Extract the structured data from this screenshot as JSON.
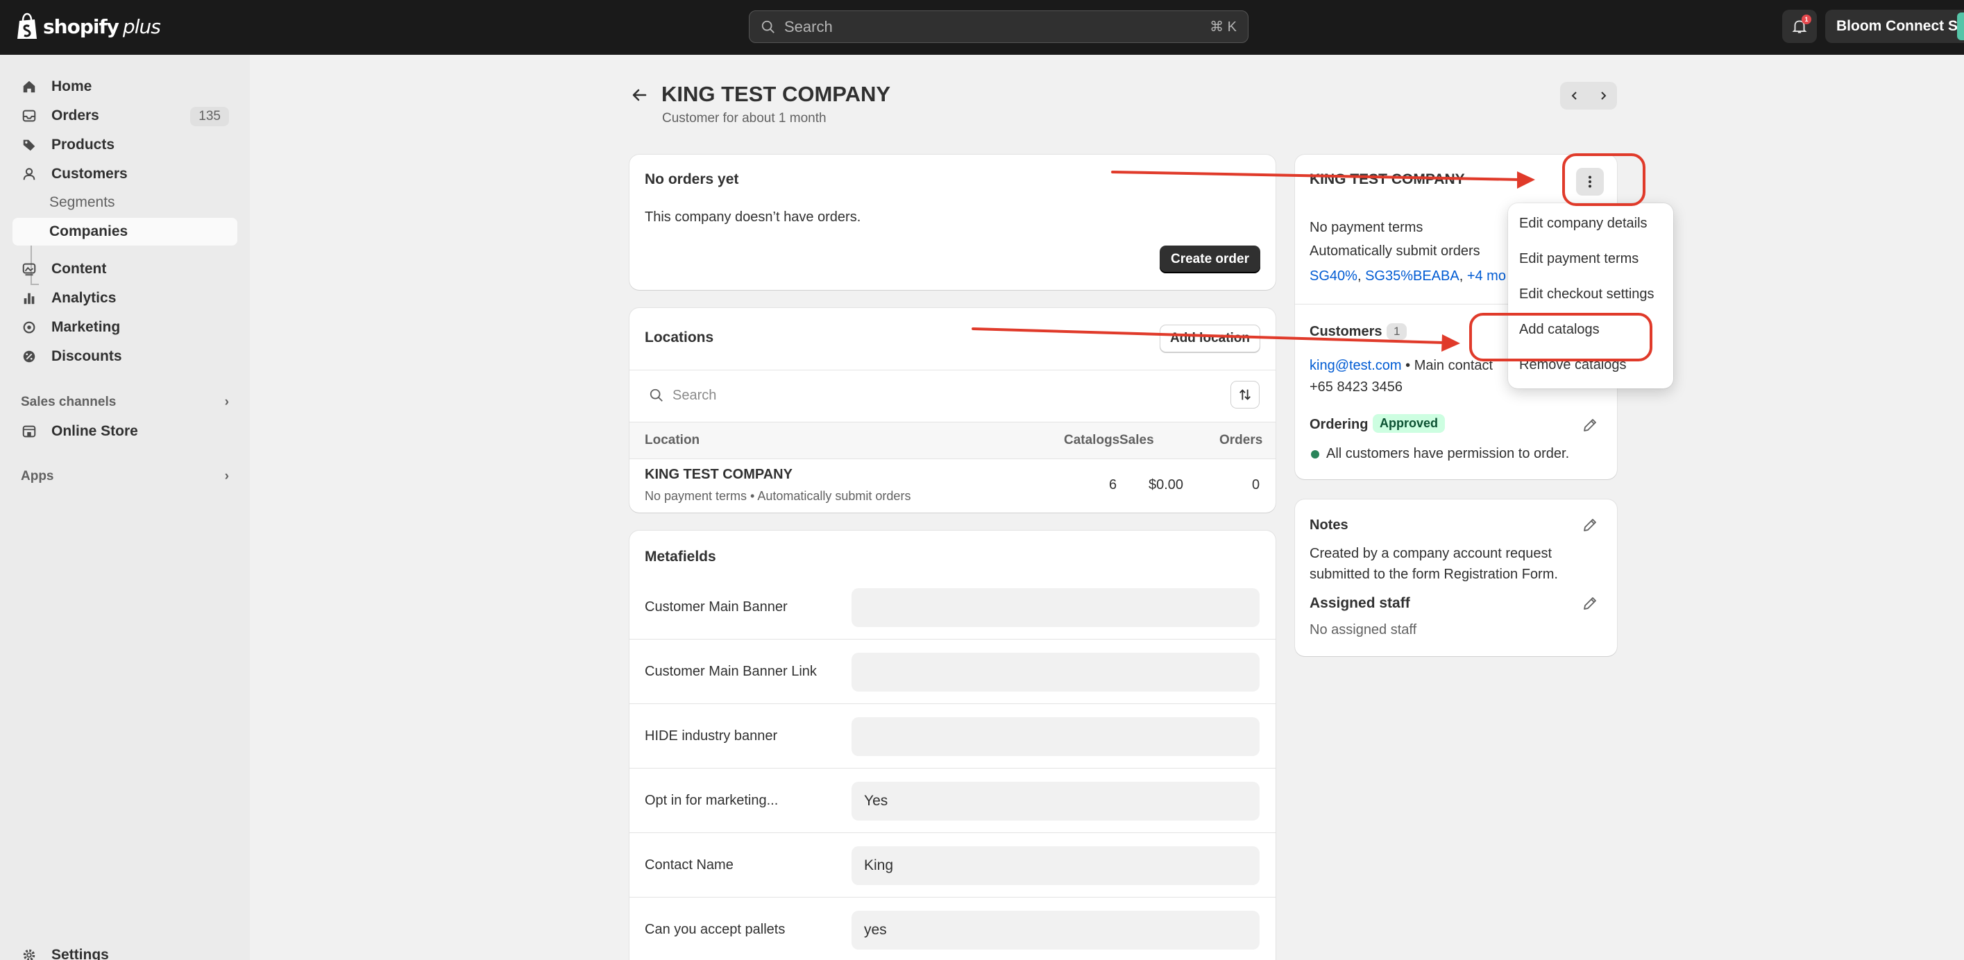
{
  "topbar": {
    "logo_word": "shopify",
    "logo_plus": "plus",
    "search_placeholder": "Search",
    "search_shortcut": "⌘ K",
    "notifications_count": "1",
    "store_name": "Bloom Connect SG"
  },
  "sidebar": {
    "items": [
      {
        "label": "Home",
        "icon": "home-icon"
      },
      {
        "label": "Orders",
        "icon": "orders-icon",
        "count": "135"
      },
      {
        "label": "Products",
        "icon": "tag-icon"
      },
      {
        "label": "Customers",
        "icon": "person-icon"
      },
      {
        "label": "Content",
        "icon": "content-icon"
      },
      {
        "label": "Analytics",
        "icon": "analytics-icon"
      },
      {
        "label": "Marketing",
        "icon": "marketing-icon"
      },
      {
        "label": "Discounts",
        "icon": "discount-icon"
      },
      {
        "label": "Online Store",
        "icon": "store-icon"
      },
      {
        "label": "Settings",
        "icon": "gear-icon"
      }
    ],
    "sub_items": [
      "Segments",
      "Companies"
    ],
    "sales_channels": "Sales channels",
    "apps": "Apps"
  },
  "page": {
    "title": "KING TEST COMPANY",
    "subtitle": "Customer for about 1 month"
  },
  "orders_card": {
    "title": "No orders yet",
    "text": "This company doesn’t have orders.",
    "button": "Create order"
  },
  "locations_card": {
    "title": "Locations",
    "add_button": "Add location",
    "search_placeholder": "Search",
    "columns": [
      "Location",
      "Catalogs",
      "Sales",
      "Orders"
    ],
    "rows": [
      {
        "name": "KING TEST COMPANY",
        "detail": "No payment terms • Automatically submit orders",
        "catalogs": "6",
        "sales": "$0.00",
        "orders": "0"
      }
    ]
  },
  "metafields_card": {
    "title": "Metafields",
    "fields": [
      {
        "label": "Customer Main Banner",
        "value": ""
      },
      {
        "label": "Customer Main Banner Link",
        "value": ""
      },
      {
        "label": "HIDE industry banner",
        "value": ""
      },
      {
        "label": "Opt in for marketing...",
        "value": "Yes"
      },
      {
        "label": "Contact Name",
        "value": "King"
      },
      {
        "label": "Can you accept pallets",
        "value": "yes"
      }
    ]
  },
  "company_card": {
    "title": "KING TEST COMPANY",
    "payment_terms": "No payment terms",
    "auto_submit": "Automatically submit orders",
    "catalog_1": "SG40%",
    "catalog_2": "SG35%BEABA",
    "catalog_more": "+4 mo",
    "customers_label": "Customers",
    "customers_count": "1",
    "contact_email": "king@test.com",
    "contact_role": "• Main contact",
    "contact_phone": "+65 8423 3456",
    "ordering_label": "Ordering",
    "ordering_status": "Approved",
    "ordering_text": "All customers have permission to order."
  },
  "notes_card": {
    "title": "Notes",
    "text_line1": "Created by a company account request",
    "text_line2": "submitted to the form Registration Form.",
    "staff_title": "Assigned staff",
    "staff_text": "No assigned staff"
  },
  "dropdown": {
    "items": [
      "Edit company details",
      "Edit payment terms",
      "Edit checkout settings",
      "Add catalogs",
      "Remove catalogs"
    ]
  },
  "annotation_color": "#e03a2a"
}
